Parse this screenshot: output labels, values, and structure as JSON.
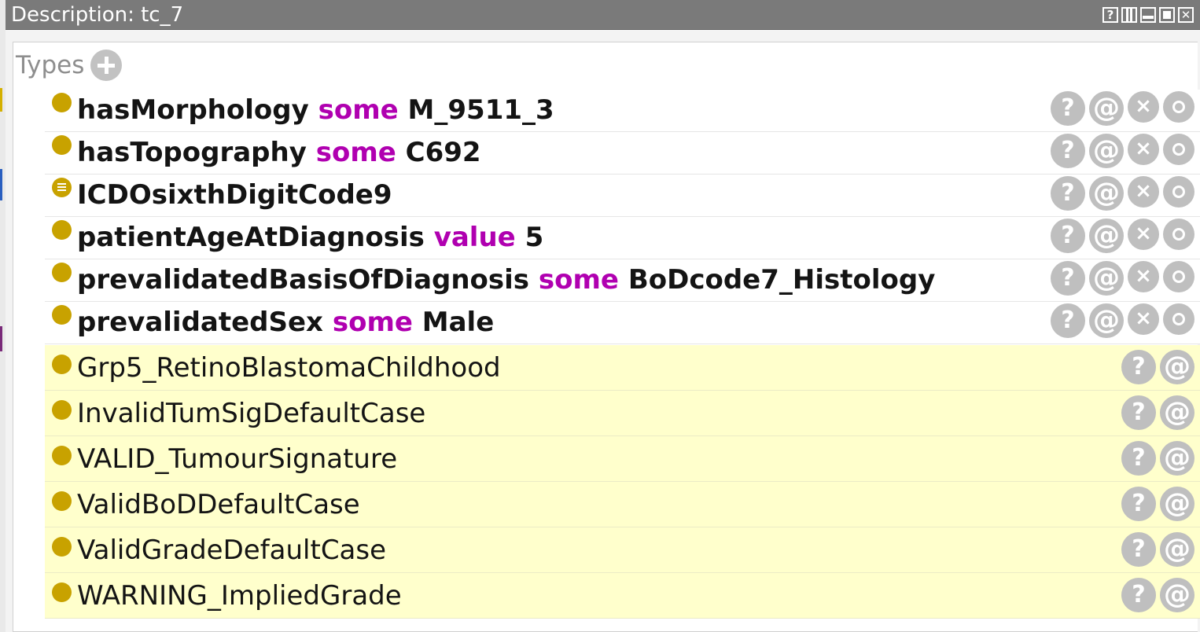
{
  "window": {
    "title": "Description: tc_7"
  },
  "window_controls": [
    "help-icon",
    "split-icon",
    "minimize-icon",
    "maximize-icon",
    "close-icon"
  ],
  "section": {
    "title": "Types",
    "add_icon": "plus-icon"
  },
  "asserted_types": [
    {
      "property": "hasMorphology",
      "keyword": "some",
      "filler": "M_9511_3",
      "icon": "class-bullet-icon"
    },
    {
      "property": "hasTopography",
      "keyword": "some",
      "filler": "C692",
      "icon": "class-bullet-icon"
    },
    {
      "property": "ICDOsixthDigitCode9",
      "keyword": "",
      "filler": "",
      "icon": "defined-class-bullet-icon"
    },
    {
      "property": "patientAgeAtDiagnosis",
      "keyword": "value",
      "filler": "5",
      "icon": "class-bullet-icon"
    },
    {
      "property": "prevalidatedBasisOfDiagnosis",
      "keyword": "some",
      "filler": "BoDcode7_Histology",
      "icon": "class-bullet-icon"
    },
    {
      "property": "prevalidatedSex",
      "keyword": "some",
      "filler": "Male",
      "icon": "class-bullet-icon"
    }
  ],
  "asserted_actions": {
    "explain": "?",
    "annotate": "@",
    "delete": "×"
  },
  "inferred_types": [
    {
      "name": "Grp5_RetinoBlastomaChildhood"
    },
    {
      "name": "InvalidTumSigDefaultCase"
    },
    {
      "name": "VALID_TumourSignature"
    },
    {
      "name": "ValidBoDDefaultCase"
    },
    {
      "name": "ValidGradeDefaultCase"
    },
    {
      "name": "WARNING_ImpliedGrade"
    }
  ],
  "inferred_actions": {
    "explain": "?",
    "annotate": "@"
  },
  "colors": {
    "titlebar": "#7a7a7a",
    "keyword": "#b000b0",
    "bullet": "#c8a200",
    "inferred_background": "#ffffcc",
    "action_button": "#bfbfbf"
  }
}
